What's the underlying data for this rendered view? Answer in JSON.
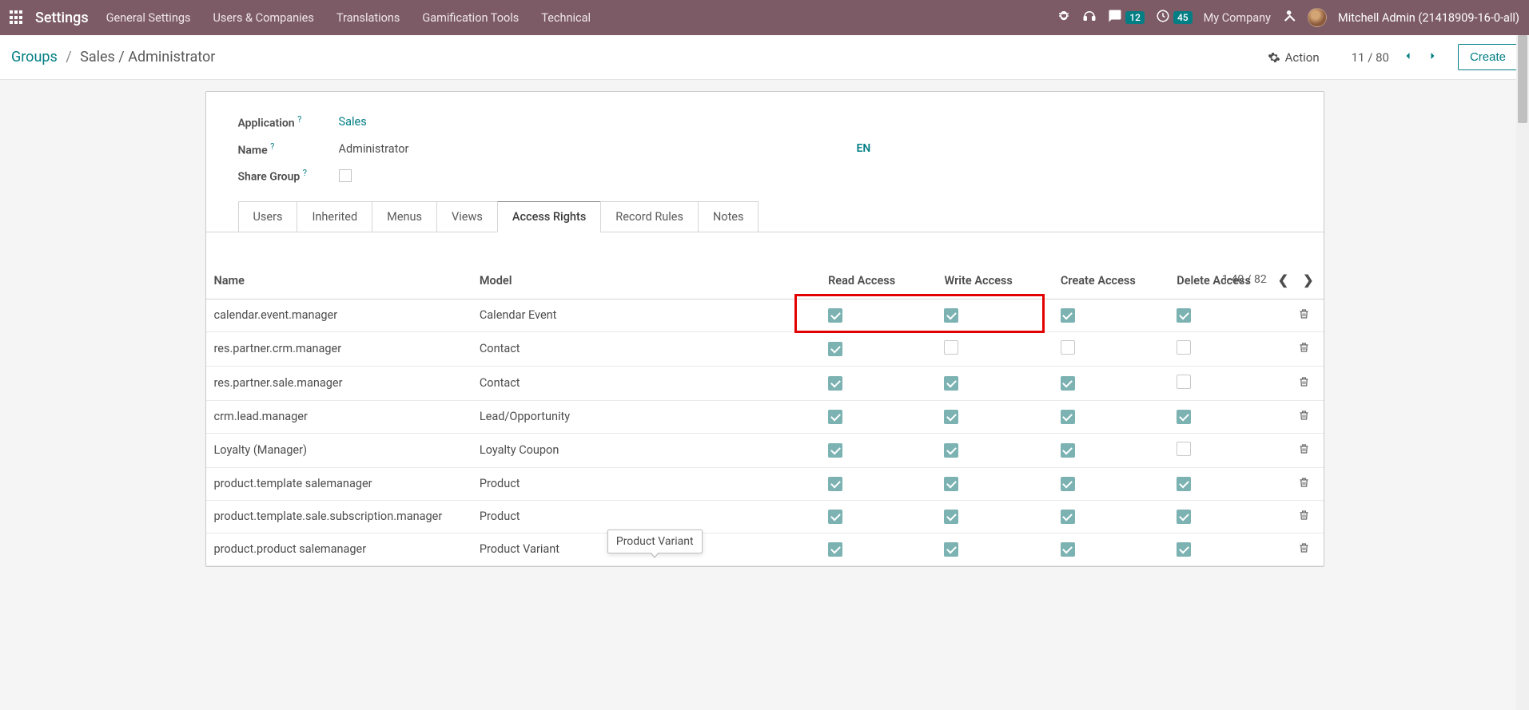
{
  "topbar": {
    "brand": "Settings",
    "menu": [
      "General Settings",
      "Users & Companies",
      "Translations",
      "Gamification Tools",
      "Technical"
    ],
    "chat_badge": "12",
    "timer_badge": "45",
    "company": "My Company",
    "user": "Mitchell Admin (21418909-16-0-all)"
  },
  "ctrl": {
    "crumb_root": "Groups",
    "crumb_leaf": "Sales / Administrator",
    "action_label": "Action",
    "pager": "11 / 80",
    "create_label": "Create"
  },
  "form": {
    "app_label": "Application",
    "app_value": "Sales",
    "name_label": "Name",
    "name_value": "Administrator",
    "en_badge": "EN",
    "share_label": "Share Group"
  },
  "tabs": [
    "Users",
    "Inherited",
    "Menus",
    "Views",
    "Access Rights",
    "Record Rules",
    "Notes"
  ],
  "active_tab_index": 4,
  "list_pager": "1-40 / 82",
  "columns": {
    "name": "Name",
    "model": "Model",
    "read": "Read Access",
    "write": "Write Access",
    "create": "Create Access",
    "del": "Delete Access"
  },
  "rows": [
    {
      "name": "calendar.event.manager",
      "model": "Calendar Event",
      "r": true,
      "w": true,
      "c": true,
      "d": true
    },
    {
      "name": "res.partner.crm.manager",
      "model": "Contact",
      "r": true,
      "w": false,
      "c": false,
      "d": false
    },
    {
      "name": "res.partner.sale.manager",
      "model": "Contact",
      "r": true,
      "w": true,
      "c": true,
      "d": false
    },
    {
      "name": "crm.lead.manager",
      "model": "Lead/Opportunity",
      "r": true,
      "w": true,
      "c": true,
      "d": true
    },
    {
      "name": "Loyalty (Manager)",
      "model": "Loyalty Coupon",
      "r": true,
      "w": true,
      "c": true,
      "d": false
    },
    {
      "name": "product.template salemanager",
      "model": "Product",
      "r": true,
      "w": true,
      "c": true,
      "d": true
    },
    {
      "name": "product.template.sale.subscription.manager",
      "model": "Product",
      "r": true,
      "w": true,
      "c": true,
      "d": true
    },
    {
      "name": "product.product salemanager",
      "model": "Product Variant",
      "r": true,
      "w": true,
      "c": true,
      "d": true
    }
  ],
  "tooltip_text": "Product Variant"
}
